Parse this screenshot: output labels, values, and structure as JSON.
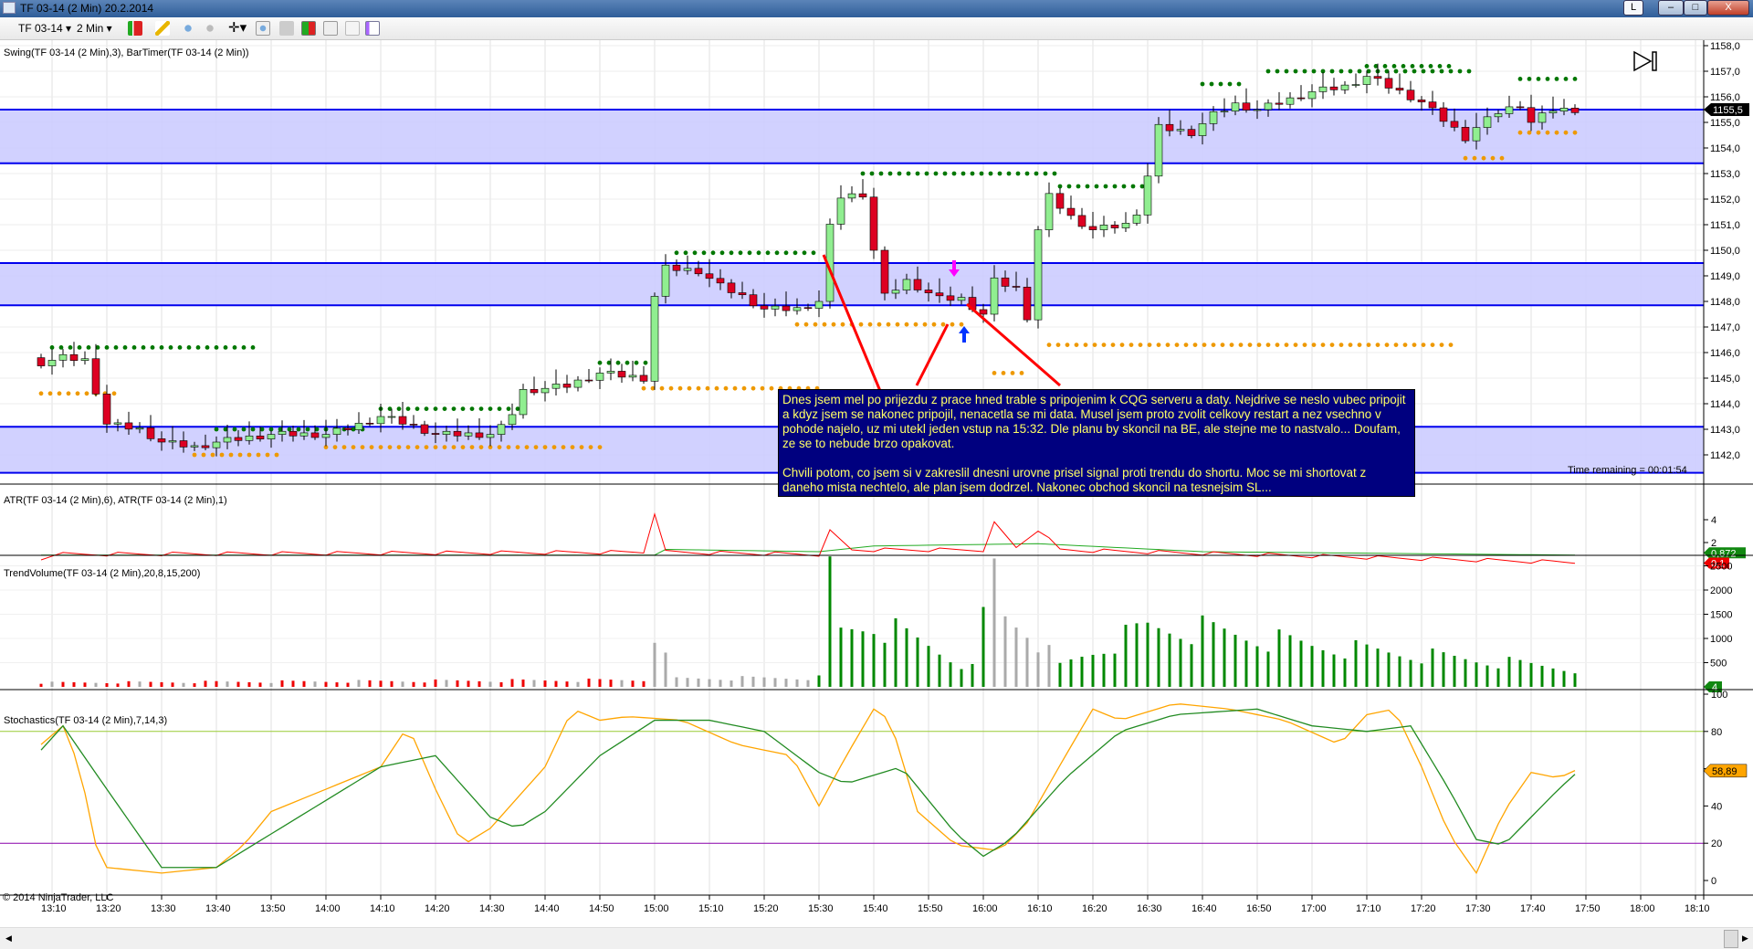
{
  "window": {
    "title": "TF 03-14 (2 Min)  20.2.2014",
    "buttons": {
      "l": "L",
      "min": "–",
      "max": "□",
      "close": "X"
    }
  },
  "toolbar": {
    "instrument": "TF 03-14",
    "interval": "2 Min"
  },
  "panels": {
    "price": {
      "label": "Swing(TF 03-14 (2 Min),3), BarTimer(TF 03-14 (2 Min))",
      "last_price": "1155,5",
      "time_remaining": "Time remaining = 00:01:54",
      "ticks": [
        "1158,0",
        "1157,0",
        "1156,0",
        "1155,0",
        "1154,0",
        "1153,0",
        "1152,0",
        "1151,0",
        "1150,0",
        "1149,0",
        "1148,0",
        "1147,0",
        "1146,0",
        "1145,0",
        "1144,0",
        "1143,0",
        "1142,0"
      ]
    },
    "atr": {
      "label": "ATR(TF 03-14 (2 Min),6), ATR(TF 03-14 (2 Min),1)",
      "ticks": [
        "4",
        "2"
      ],
      "value_slow": "0,872",
      "value_fast": "0,1"
    },
    "volume": {
      "label": "TrendVolume(TF 03-14 (2 Min),20,8,15,200)",
      "ticks": [
        "2500",
        "2000",
        "1500",
        "1000",
        "500"
      ],
      "last": "4"
    },
    "stoch": {
      "label": "Stochastics(TF 03-14 (2 Min),7,14,3)",
      "ticks": [
        "100",
        "80",
        "60",
        "40",
        "20",
        "0"
      ],
      "value_k": "58,89"
    }
  },
  "time_labels": [
    "13:10",
    "13:20",
    "13:30",
    "13:40",
    "13:50",
    "14:00",
    "14:10",
    "14:20",
    "14:30",
    "14:40",
    "14:50",
    "15:00",
    "15:10",
    "15:20",
    "15:30",
    "15:40",
    "15:50",
    "16:00",
    "16:10",
    "16:20",
    "16:30",
    "16:40",
    "16:50",
    "17:00",
    "17:10",
    "17:20",
    "17:30",
    "17:40",
    "17:50",
    "18:00",
    "18:10"
  ],
  "copyright": "© 2014 NinjaTrader, LLC",
  "note": {
    "p1": "Dnes jsem mel po prijezdu z prace hned trable s pripojenim k CQG serveru a daty. Nejdrive se neslo vubec pripojit a kdyz jsem se nakonec pripojil, nenacetla se mi data. Musel jsem proto zvolit celkovy restart a nez vsechno v pohode najelo, uz mi utekl jeden vstup na 15:32. Dle planu by skoncil na BE, ale stejne me to nastvalo... Doufam, ze se to nebude brzo opakovat.",
    "p2": "Chvili potom, co jsem si v zakreslil dnesni urovne prisel signal proti trendu do shortu. Moc se mi shortovat z daneho mista nechtelo, ale plan jsem dodrzel. Nakonec obchod skoncil na tesnejsim SL..."
  },
  "colors": {
    "zone": "#ccccff",
    "zone_line": "#0000ee",
    "up": "#90ee90",
    "down": "#dd0022",
    "swing_high": "#007700",
    "swing_low": "#ee9900",
    "vol_up": "#008800",
    "vol_down": "#ee0000",
    "vol_neutral": "#aaaaaa",
    "stoch_k": "#ffa500",
    "stoch_d": "#228b22"
  },
  "chart_data": {
    "type": "candlestick",
    "bar_minutes": 2,
    "first_bar": "13:08",
    "last_bar": "17:48",
    "price_range": [
      1141.2,
      1158.4
    ],
    "zones": [
      [
        1153.4,
        1155.5
      ],
      [
        1147.85,
        1149.5
      ],
      [
        1141.3,
        1143.1
      ]
    ],
    "close_keypoints": [
      [
        "13:08",
        1145.6
      ],
      [
        "13:12",
        1145.8
      ],
      [
        "13:16",
        1145.7
      ],
      [
        "13:18",
        1144.5
      ],
      [
        "13:20",
        1143.2
      ],
      [
        "13:26",
        1143.0
      ],
      [
        "13:30",
        1142.5
      ],
      [
        "13:36",
        1142.3
      ],
      [
        "13:40",
        1142.5
      ],
      [
        "13:50",
        1142.8
      ],
      [
        "14:00",
        1142.8
      ],
      [
        "14:05",
        1143.1
      ],
      [
        "14:10",
        1143.5
      ],
      [
        "14:15",
        1143.2
      ],
      [
        "14:20",
        1142.8
      ],
      [
        "14:30",
        1142.8
      ],
      [
        "14:33",
        1143.2
      ],
      [
        "14:36",
        1144.5
      ],
      [
        "14:44",
        1144.7
      ],
      [
        "14:50",
        1145.2
      ],
      [
        "14:58",
        1145.0
      ],
      [
        "15:00",
        1148.2
      ],
      [
        "15:02",
        1149.3
      ],
      [
        "15:08",
        1149.2
      ],
      [
        "15:12",
        1148.6
      ],
      [
        "15:16",
        1148.2
      ],
      [
        "15:20",
        1147.7
      ],
      [
        "15:26",
        1147.7
      ],
      [
        "15:30",
        1148.0
      ],
      [
        "15:32",
        1150.9
      ],
      [
        "15:34",
        1152.1
      ],
      [
        "15:38",
        1152.2
      ],
      [
        "15:40",
        1150.0
      ],
      [
        "15:42",
        1148.2
      ],
      [
        "15:46",
        1148.8
      ],
      [
        "15:52",
        1148.1
      ],
      [
        "15:56",
        1148.1
      ],
      [
        "16:00",
        1147.5
      ],
      [
        "16:02",
        1148.8
      ],
      [
        "16:06",
        1148.5
      ],
      [
        "16:08",
        1147.4
      ],
      [
        "16:10",
        1150.8
      ],
      [
        "16:12",
        1152.1
      ],
      [
        "16:16",
        1151.3
      ],
      [
        "16:20",
        1150.8
      ],
      [
        "16:26",
        1151.0
      ],
      [
        "16:28",
        1151.5
      ],
      [
        "16:30",
        1152.9
      ],
      [
        "16:32",
        1154.8
      ],
      [
        "16:38",
        1154.6
      ],
      [
        "16:42",
        1155.3
      ],
      [
        "16:46",
        1155.7
      ],
      [
        "16:50",
        1155.5
      ],
      [
        "16:56",
        1155.9
      ],
      [
        "17:00",
        1156.2
      ],
      [
        "17:06",
        1156.4
      ],
      [
        "17:10",
        1156.8
      ],
      [
        "17:14",
        1156.4
      ],
      [
        "17:20",
        1155.8
      ],
      [
        "17:24",
        1155.1
      ],
      [
        "17:28",
        1154.4
      ],
      [
        "17:30",
        1154.8
      ],
      [
        "17:34",
        1155.4
      ],
      [
        "17:38",
        1155.7
      ],
      [
        "17:40",
        1155.0
      ],
      [
        "17:44",
        1155.5
      ],
      [
        "17:48",
        1155.5
      ]
    ],
    "swing_highs": [
      [
        "13:10",
        "13:48",
        1146.2
      ],
      [
        "13:40",
        "14:08",
        1143.0
      ],
      [
        "14:10",
        "14:36",
        1143.8
      ],
      [
        "14:50",
        "15:00",
        1145.6
      ],
      [
        "15:04",
        "15:30",
        1149.9
      ],
      [
        "15:38",
        "16:14",
        1153.0
      ],
      [
        "16:14",
        "16:30",
        1152.5
      ],
      [
        "16:40",
        "16:48",
        1156.5
      ],
      [
        "16:52",
        "17:30",
        1157.0
      ],
      [
        "17:10",
        "17:26",
        1157.2
      ],
      [
        "17:38",
        "17:48",
        1156.7
      ]
    ],
    "swing_lows": [
      [
        "13:08",
        "13:22",
        1144.4
      ],
      [
        "13:36",
        "13:52",
        1142.0
      ],
      [
        "14:00",
        "14:50",
        1142.3
      ],
      [
        "14:58",
        "15:30",
        1144.6
      ],
      [
        "15:26",
        "15:56",
        1147.1
      ],
      [
        "16:02",
        "16:08",
        1145.2
      ],
      [
        "16:12",
        "17:26",
        1146.3
      ],
      [
        "17:28",
        "17:36",
        1153.6
      ],
      [
        "17:38",
        "17:48",
        1154.6
      ]
    ],
    "volume_keypoints": [
      [
        "13:08",
        90,
        "down"
      ],
      [
        "14:58",
        150,
        "down"
      ],
      [
        "15:00",
        1300,
        "neutral"
      ],
      [
        "15:02",
        600,
        "neutral"
      ],
      [
        "15:04",
        180,
        "neutral"
      ],
      [
        "15:30",
        200,
        "up"
      ],
      [
        "15:32",
        2450,
        "up"
      ],
      [
        "15:34",
        1200,
        "up"
      ],
      [
        "15:40",
        1400,
        "up"
      ],
      [
        "15:50",
        900,
        "up"
      ],
      [
        "15:58",
        400,
        "up"
      ],
      [
        "16:02",
        2600,
        "neutral"
      ],
      [
        "16:04",
        1550,
        "neutral"
      ],
      [
        "16:08",
        1300,
        "neutral"
      ],
      [
        "16:14",
        450,
        "up"
      ],
      [
        "16:30",
        1300,
        "up"
      ],
      [
        "16:40",
        1250,
        "up"
      ],
      [
        "17:00",
        900,
        "up"
      ],
      [
        "17:48",
        400,
        "up"
      ]
    ],
    "atr_slow": [
      [
        "13:08",
        0.9
      ],
      [
        "15:00",
        0.9
      ],
      [
        "15:02",
        1.4
      ],
      [
        "15:30",
        1.2
      ],
      [
        "15:40",
        1.7
      ],
      [
        "16:10",
        1.9
      ],
      [
        "16:40",
        1.2
      ],
      [
        "17:48",
        0.9
      ]
    ],
    "atr_fast": [
      [
        "13:08",
        0.8
      ],
      [
        "14:58",
        1.0
      ],
      [
        "15:00",
        4.5
      ],
      [
        "15:02",
        1.0
      ],
      [
        "15:30",
        0.8
      ],
      [
        "15:32",
        2.8
      ],
      [
        "15:36",
        1.2
      ],
      [
        "16:00",
        1.2
      ],
      [
        "16:02",
        3.5
      ],
      [
        "16:06",
        1.4
      ],
      [
        "16:10",
        3.0
      ],
      [
        "16:14",
        1.2
      ],
      [
        "17:48",
        0.1
      ]
    ],
    "stoch_k": [
      [
        "13:08",
        73
      ],
      [
        "13:12",
        83
      ],
      [
        "13:15",
        61
      ],
      [
        "13:18",
        19
      ],
      [
        "13:20",
        7
      ],
      [
        "13:30",
        4
      ],
      [
        "13:40",
        7
      ],
      [
        "13:45",
        19
      ],
      [
        "13:50",
        37
      ],
      [
        "14:00",
        49
      ],
      [
        "14:10",
        61
      ],
      [
        "14:15",
        83
      ],
      [
        "14:20",
        49
      ],
      [
        "14:25",
        19
      ],
      [
        "14:30",
        28
      ],
      [
        "14:40",
        61
      ],
      [
        "14:45",
        92
      ],
      [
        "14:50",
        86
      ],
      [
        "14:55",
        88
      ],
      [
        "15:05",
        86
      ],
      [
        "15:15",
        73
      ],
      [
        "15:25",
        67
      ],
      [
        "15:30",
        40
      ],
      [
        "15:35",
        67
      ],
      [
        "15:40",
        92
      ],
      [
        "15:43",
        86
      ],
      [
        "15:48",
        37
      ],
      [
        "15:55",
        19
      ],
      [
        "16:03",
        16
      ],
      [
        "16:08",
        31
      ],
      [
        "16:15",
        67
      ],
      [
        "16:20",
        92
      ],
      [
        "16:25",
        86
      ],
      [
        "16:35",
        95
      ],
      [
        "16:45",
        92
      ],
      [
        "16:55",
        86
      ],
      [
        "17:05",
        73
      ],
      [
        "17:10",
        89
      ],
      [
        "17:15",
        92
      ],
      [
        "17:20",
        61
      ],
      [
        "17:25",
        25
      ],
      [
        "17:30",
        4
      ],
      [
        "17:35",
        37
      ],
      [
        "17:40",
        58
      ],
      [
        "17:45",
        55
      ],
      [
        "17:48",
        59
      ]
    ],
    "stoch_d": [
      [
        "13:08",
        70
      ],
      [
        "13:12",
        83
      ],
      [
        "13:20",
        49
      ],
      [
        "13:30",
        7
      ],
      [
        "13:40",
        7
      ],
      [
        "13:50",
        25
      ],
      [
        "14:00",
        43
      ],
      [
        "14:10",
        61
      ],
      [
        "14:20",
        67
      ],
      [
        "14:30",
        34
      ],
      [
        "14:35",
        28
      ],
      [
        "14:40",
        37
      ],
      [
        "14:50",
        67
      ],
      [
        "15:00",
        86
      ],
      [
        "15:10",
        86
      ],
      [
        "15:20",
        80
      ],
      [
        "15:30",
        58
      ],
      [
        "15:35",
        52
      ],
      [
        "15:45",
        61
      ],
      [
        "15:55",
        25
      ],
      [
        "16:00",
        13
      ],
      [
        "16:05",
        22
      ],
      [
        "16:15",
        55
      ],
      [
        "16:25",
        80
      ],
      [
        "16:35",
        89
      ],
      [
        "16:50",
        92
      ],
      [
        "17:00",
        83
      ],
      [
        "17:10",
        80
      ],
      [
        "17:18",
        83
      ],
      [
        "17:25",
        49
      ],
      [
        "17:30",
        22
      ],
      [
        "17:35",
        19
      ],
      [
        "17:45",
        49
      ],
      [
        "17:48",
        57
      ]
    ],
    "stoch_levels": [
      80,
      20
    ]
  }
}
